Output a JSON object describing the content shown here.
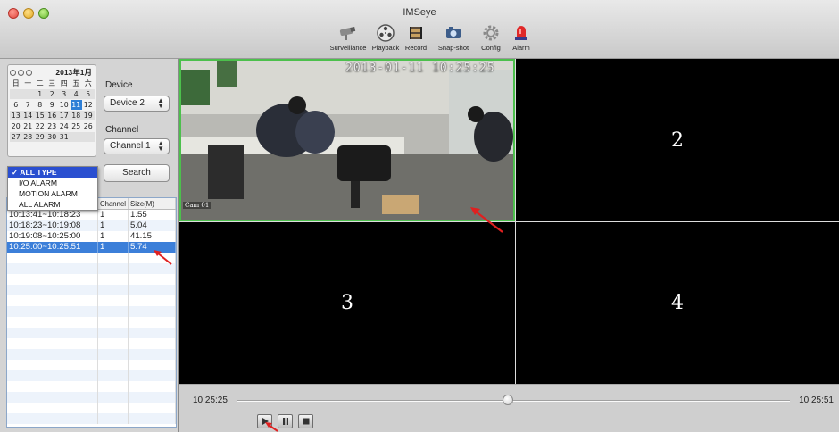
{
  "window": {
    "title": "IMSeye"
  },
  "toolbar": {
    "items": [
      {
        "label": "Surveillance",
        "icon": "camera-icon"
      },
      {
        "label": "Playback",
        "icon": "playback-reel-icon"
      },
      {
        "label": "Record",
        "icon": "record-film-icon"
      },
      {
        "label": "Snap-shot",
        "icon": "snapshot-icon"
      },
      {
        "label": "Config",
        "icon": "gear-icon"
      },
      {
        "label": "Alarm",
        "icon": "alarm-siren-icon"
      }
    ]
  },
  "calendar": {
    "title": "2013年1月",
    "weekdays": [
      "日",
      "一",
      "二",
      "三",
      "四",
      "五",
      "六"
    ],
    "days": [
      "",
      "",
      "1",
      "2",
      "3",
      "4",
      "5",
      "6",
      "7",
      "8",
      "9",
      "10",
      "11",
      "12",
      "13",
      "14",
      "15",
      "16",
      "17",
      "18",
      "19",
      "20",
      "21",
      "22",
      "23",
      "24",
      "25",
      "26",
      "27",
      "28",
      "29",
      "30",
      "31",
      "",
      ""
    ],
    "selected": "11"
  },
  "device": {
    "label": "Device",
    "value": "Device 2"
  },
  "channel": {
    "label": "Channel",
    "value": "Channel 1"
  },
  "search_label": "Search",
  "type_menu": {
    "options": [
      "ALL TYPE",
      "I/O ALARM",
      "MOTION ALARM",
      "ALL ALARM"
    ],
    "selected_prefix": "✓ "
  },
  "records": {
    "headers": [
      "",
      "Channel",
      "Size(M)"
    ],
    "rows": [
      {
        "time": "10:13:41~10:18:23",
        "channel": "1",
        "size": "1.55"
      },
      {
        "time": "10:18:23~10:19:08",
        "channel": "1",
        "size": "5.04"
      },
      {
        "time": "10:19:08~10:25:00",
        "channel": "1",
        "size": "41.15"
      },
      {
        "time": "10:25:00~10:25:51",
        "channel": "1",
        "size": "5.74"
      }
    ],
    "selected_index": 3
  },
  "video": {
    "timestamp": "2013-01-11 10:25:25",
    "camera_label": "Cam 01",
    "cells": [
      "",
      "2",
      "3",
      "4"
    ]
  },
  "playback": {
    "start_time": "10:25:25",
    "end_time": "10:25:51",
    "position": 0.49
  },
  "colors": {
    "selection": "#3c7fd9",
    "menu_highlight": "#2a4fd0",
    "active_border": "#4cc04c",
    "annotation_arrow": "#e02020"
  }
}
